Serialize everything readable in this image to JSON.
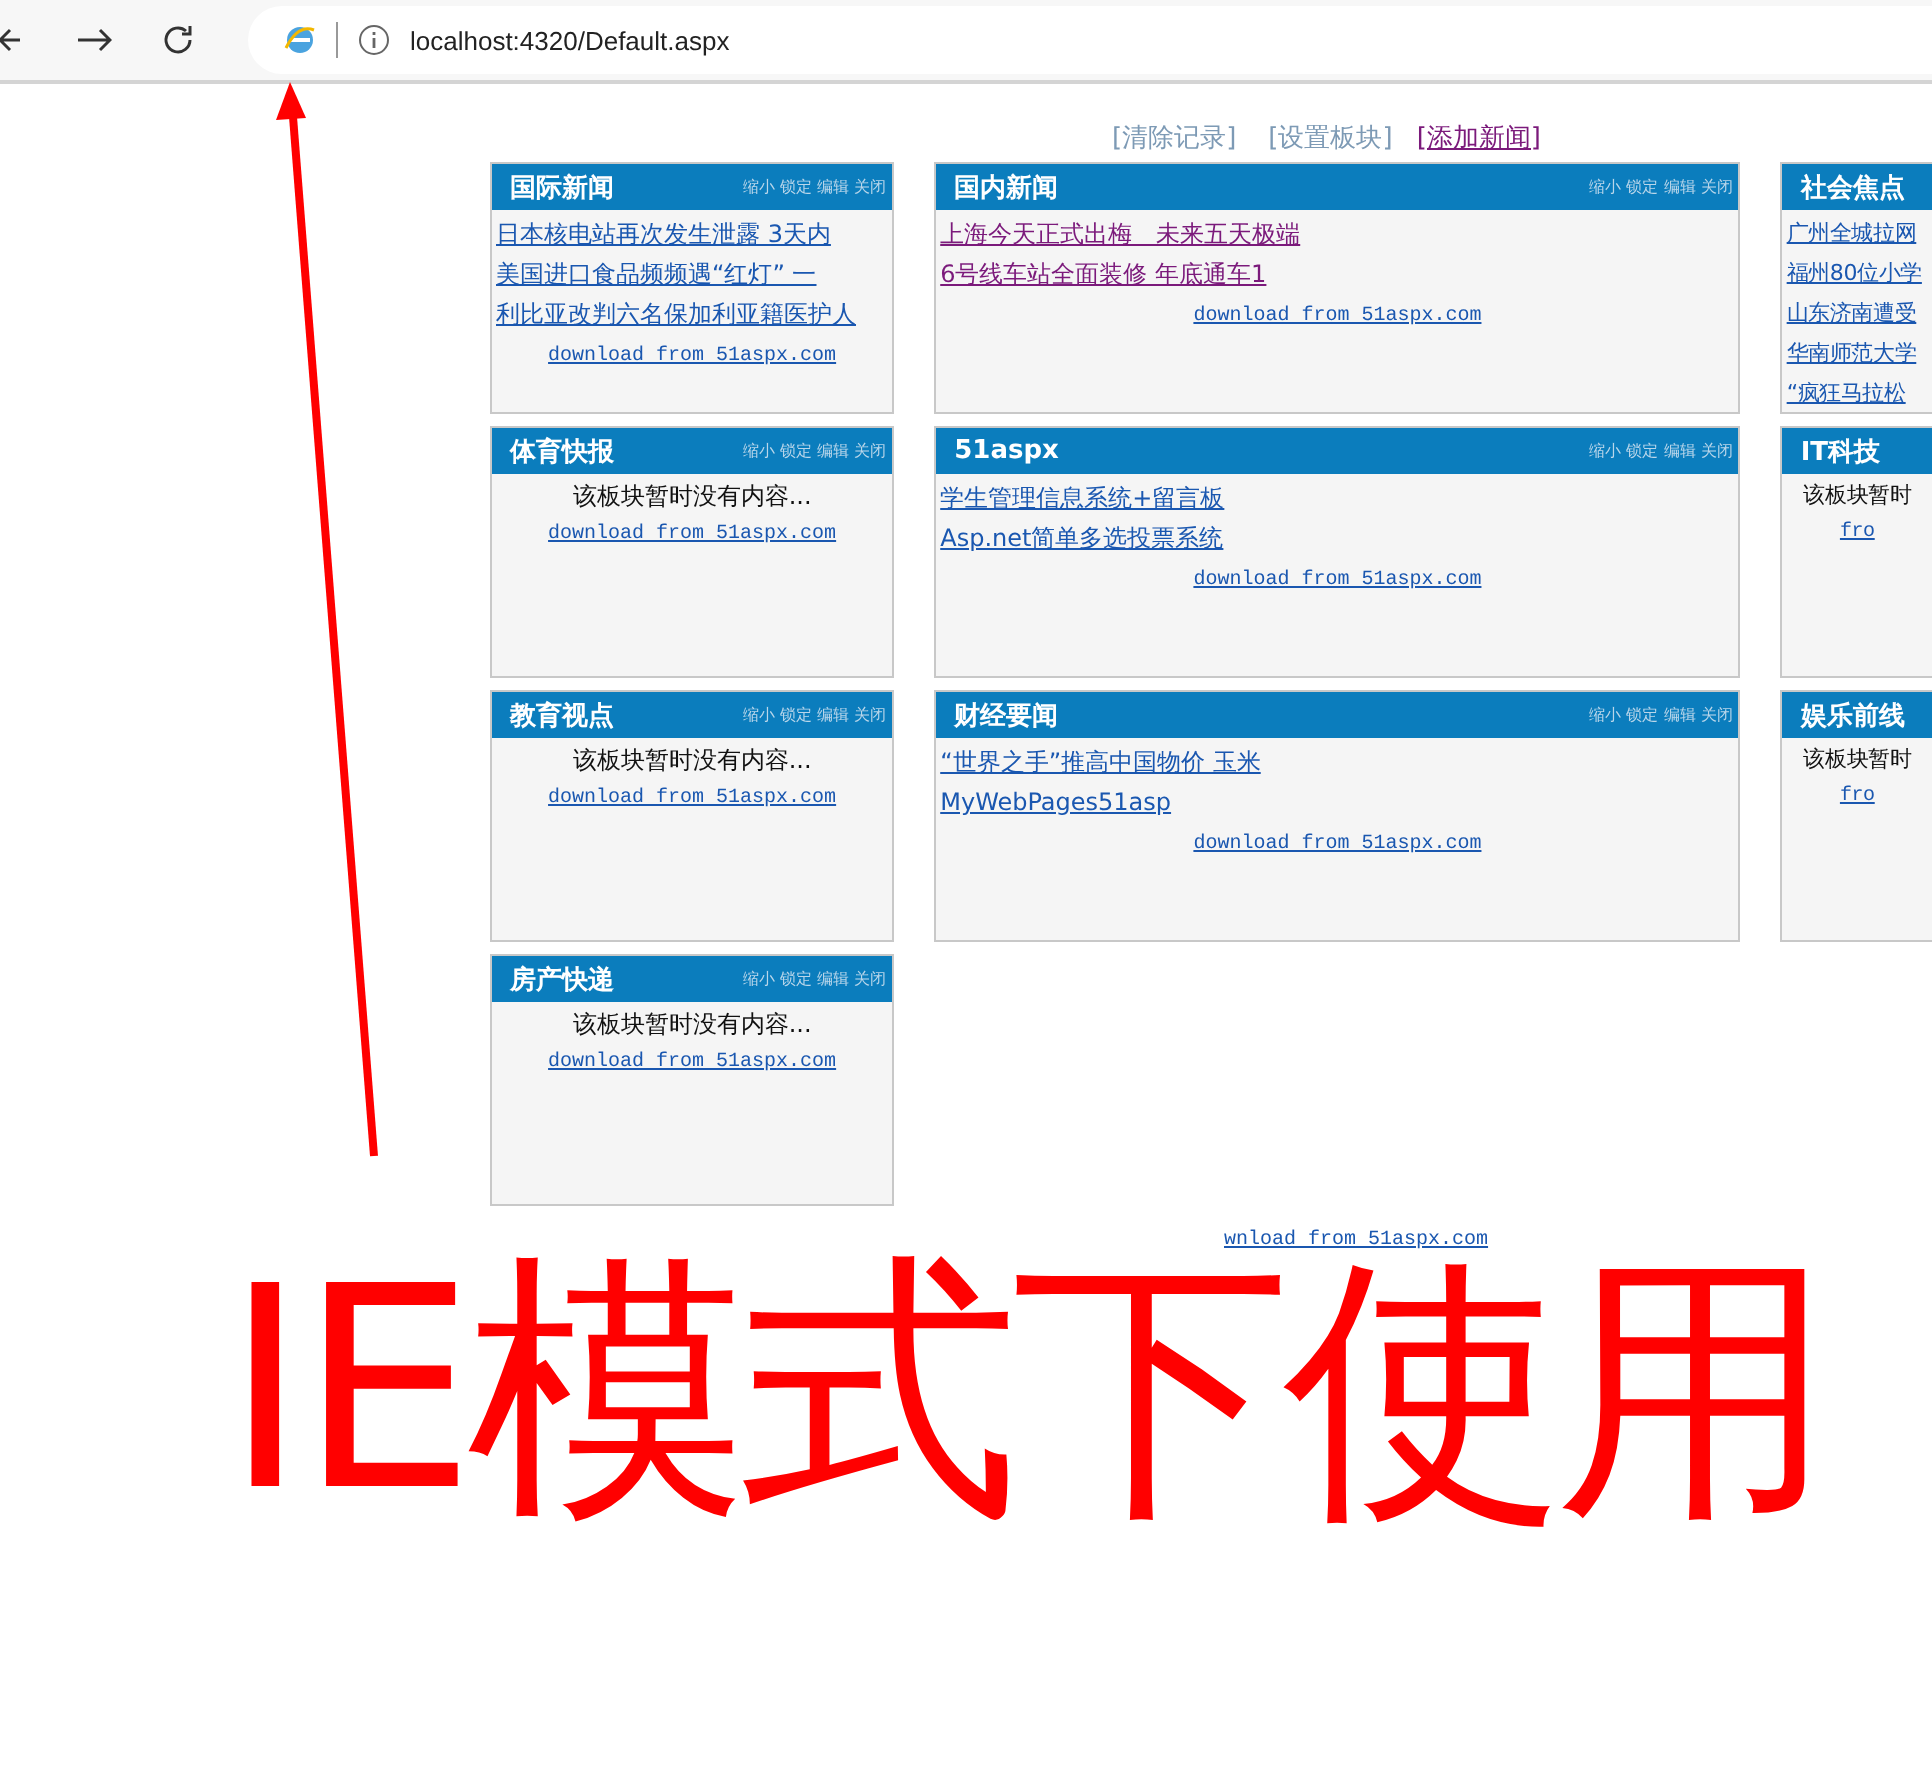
{
  "browser": {
    "url": "localhost:4320/Default.aspx"
  },
  "toolbar_links": [
    {
      "label": "[清除记录]",
      "visited": false
    },
    {
      "label": "[设置板块]",
      "visited": false
    },
    {
      "label": "[添加新闻]",
      "visited": true
    }
  ],
  "columns": [
    {
      "panels": [
        {
          "title": "国际新闻",
          "actions": "缩小 锁定 编辑 关闭",
          "items": [
            {
              "kind": "link",
              "text": "日本核电站再次发生泄露 3天内",
              "visited": false
            },
            {
              "kind": "link",
              "text": "美国进口食品频频遇“红灯” 一",
              "visited": false
            },
            {
              "kind": "link",
              "text": "利比亚改判六名保加利亚籍医护人",
              "visited": false
            }
          ],
          "download": "download from 51aspx.com"
        },
        {
          "title": "体育快报",
          "actions": "缩小 锁定 编辑 关闭",
          "items": [
            {
              "kind": "empty",
              "text": "该板块暂时没有内容..."
            }
          ],
          "download": "download from 51aspx.com"
        },
        {
          "title": "教育视点",
          "actions": "缩小 锁定 编辑 关闭",
          "items": [
            {
              "kind": "empty",
              "text": "该板块暂时没有内容..."
            }
          ],
          "download": "download from 51aspx.com"
        },
        {
          "title": "房产快递",
          "actions": "缩小 锁定 编辑 关闭",
          "items": [
            {
              "kind": "empty",
              "text": "该板块暂时没有内容..."
            }
          ],
          "download": "download from 51aspx.com"
        }
      ]
    },
    {
      "panels": [
        {
          "title": "国内新闻",
          "actions": "缩小 锁定 编辑 关闭",
          "items": [
            {
              "kind": "link",
              "text": "上海今天正式出梅　未来五天极端",
              "visited": true
            },
            {
              "kind": "link",
              "text": "6号线车站全面装修 年底通车1",
              "visited": true
            }
          ],
          "download": "download from 51aspx.com"
        },
        {
          "title": "51aspx",
          "actions": "缩小 锁定 编辑 关闭",
          "items": [
            {
              "kind": "link",
              "text": "学生管理信息系统+留言板",
              "visited": false
            },
            {
              "kind": "link",
              "text": "Asp.net简单多选投票系统",
              "visited": false
            }
          ],
          "download": "download from 51aspx.com"
        },
        {
          "title": "财经要闻",
          "actions": "缩小 锁定 编辑 关闭",
          "items": [
            {
              "kind": "link",
              "text": "“世界之手”推高中国物价 玉米",
              "visited": false
            },
            {
              "kind": "link",
              "text": "MyWebPages51asp",
              "visited": false
            }
          ],
          "download": "download from 51aspx.com"
        }
      ]
    },
    {
      "panels": [
        {
          "title": "社会焦点",
          "items": [
            {
              "kind": "link",
              "text": "广州全城拉网",
              "visited": false
            },
            {
              "kind": "link",
              "text": "福州80位小学",
              "visited": false
            },
            {
              "kind": "link",
              "text": "山东济南遭受",
              "visited": false
            },
            {
              "kind": "link",
              "text": "华南师范大学",
              "visited": false
            },
            {
              "kind": "link",
              "text": "“疯狂马拉松",
              "visited": false
            }
          ]
        },
        {
          "title": "IT科技",
          "items": [
            {
              "kind": "empty",
              "text": "该板块暂时"
            }
          ],
          "download": "fro"
        },
        {
          "title": "娱乐前线",
          "items": [
            {
              "kind": "empty",
              "text": "该板块暂时"
            }
          ],
          "download": "fro"
        }
      ]
    }
  ],
  "footer_link": "wnload from 51aspx.com",
  "annotation": {
    "text": "IE模式下使用"
  }
}
